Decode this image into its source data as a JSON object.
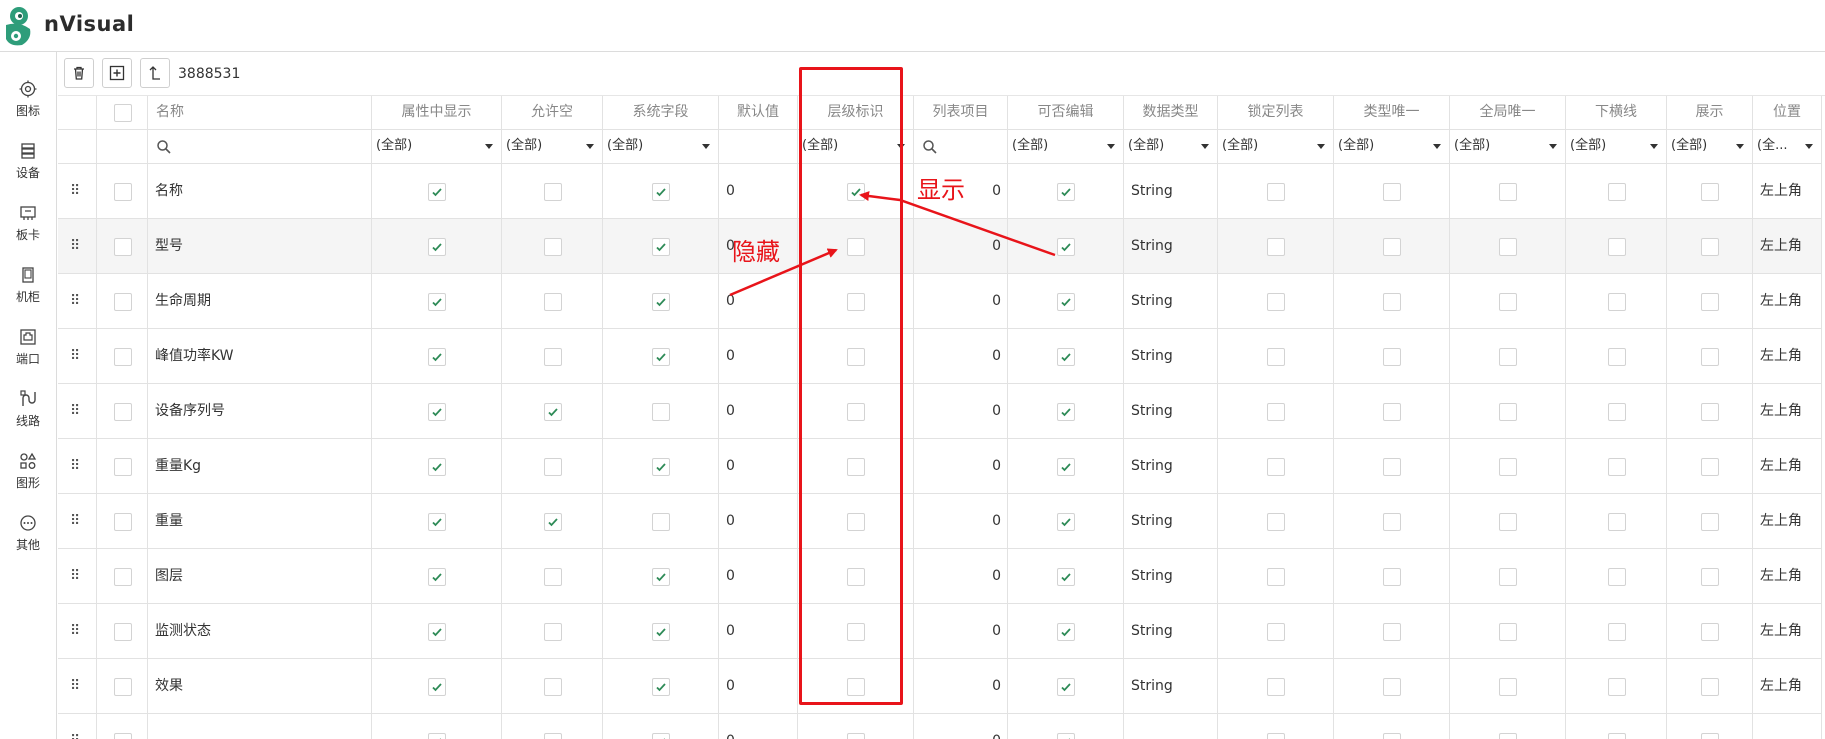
{
  "app": {
    "brand": "nVisual",
    "accent_color": "#2e9d7a",
    "check_color": "#2e8b57",
    "annotation_color": "#e8141a"
  },
  "sidebar": {
    "items": [
      {
        "label": "图标",
        "icon": "target-icon"
      },
      {
        "label": "设备",
        "icon": "server-icon"
      },
      {
        "label": "板卡",
        "icon": "board-icon"
      },
      {
        "label": "机柜",
        "icon": "cabinet-icon"
      },
      {
        "label": "端口",
        "icon": "port-icon"
      },
      {
        "label": "线路",
        "icon": "cable-icon"
      },
      {
        "label": "图形",
        "icon": "shapes-icon"
      },
      {
        "label": "其他",
        "icon": "more-icon"
      }
    ]
  },
  "toolbar": {
    "id_text": "3888531"
  },
  "table": {
    "columns": [
      "名称",
      "属性中显示",
      "允许空",
      "系统字段",
      "默认值",
      "层级标识",
      "列表项目",
      "可否编辑",
      "数据类型",
      "锁定列表",
      "类型唯一",
      "全局唯一",
      "下横线",
      "展示",
      "位置"
    ],
    "filters": [
      "search",
      "(全部)",
      "(全部)",
      "(全部)",
      "",
      "(全部)",
      "search",
      "(全部)",
      "(全部)",
      "(全部)",
      "(全部)",
      "(全部)",
      "(全部)",
      "(全部)",
      "(全..."
    ],
    "rows": [
      {
        "name": "名称",
        "show_in_attr": true,
        "nullable": false,
        "system": true,
        "default": "0",
        "level_mark": true,
        "list_item": "0",
        "editable": true,
        "data_type": "String",
        "position": "左上角"
      },
      {
        "name": "型号",
        "show_in_attr": true,
        "nullable": false,
        "system": true,
        "default": "0",
        "level_mark": false,
        "list_item": "0",
        "editable": true,
        "data_type": "String",
        "position": "左上角"
      },
      {
        "name": "生命周期",
        "show_in_attr": true,
        "nullable": false,
        "system": true,
        "default": "0",
        "level_mark": false,
        "list_item": "0",
        "editable": true,
        "data_type": "String",
        "position": "左上角"
      },
      {
        "name": "峰值功率KW",
        "show_in_attr": true,
        "nullable": false,
        "system": true,
        "default": "0",
        "level_mark": false,
        "list_item": "0",
        "editable": true,
        "data_type": "String",
        "position": "左上角"
      },
      {
        "name": "设备序列号",
        "show_in_attr": true,
        "nullable": true,
        "system": false,
        "default": "0",
        "level_mark": false,
        "list_item": "0",
        "editable": true,
        "data_type": "String",
        "position": "左上角"
      },
      {
        "name": "重量Kg",
        "show_in_attr": true,
        "nullable": false,
        "system": true,
        "default": "0",
        "level_mark": false,
        "list_item": "0",
        "editable": true,
        "data_type": "String",
        "position": "左上角"
      },
      {
        "name": "重量",
        "show_in_attr": true,
        "nullable": true,
        "system": false,
        "default": "0",
        "level_mark": false,
        "list_item": "0",
        "editable": true,
        "data_type": "String",
        "position": "左上角"
      },
      {
        "name": "图层",
        "show_in_attr": true,
        "nullable": false,
        "system": true,
        "default": "0",
        "level_mark": false,
        "list_item": "0",
        "editable": true,
        "data_type": "String",
        "position": "左上角"
      },
      {
        "name": "监测状态",
        "show_in_attr": true,
        "nullable": false,
        "system": true,
        "default": "0",
        "level_mark": false,
        "list_item": "0",
        "editable": true,
        "data_type": "String",
        "position": "左上角"
      },
      {
        "name": "效果",
        "show_in_attr": true,
        "nullable": false,
        "system": true,
        "default": "0",
        "level_mark": false,
        "list_item": "0",
        "editable": true,
        "data_type": "String",
        "position": "左上角"
      },
      {
        "name": "",
        "show_in_attr": true,
        "nullable": false,
        "system": true,
        "default": "0",
        "level_mark": false,
        "list_item": "0",
        "editable": true,
        "data_type": "",
        "position": ""
      }
    ]
  },
  "annotations": {
    "show_label": "显示",
    "hide_label": "隐藏"
  }
}
